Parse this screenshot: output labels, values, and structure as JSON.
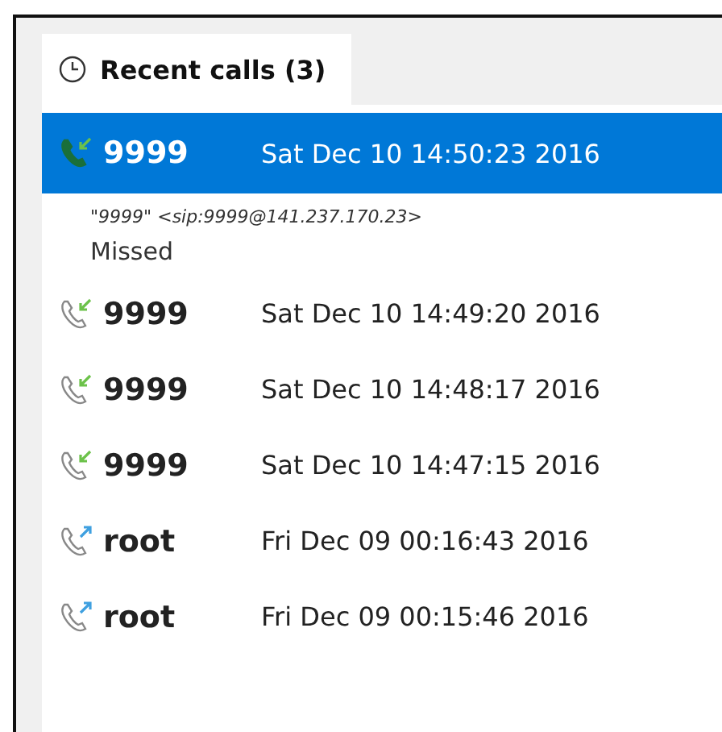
{
  "tab": {
    "label": "Recent calls (3)",
    "selected": true
  },
  "calls": [
    {
      "kind": "incoming",
      "name": "9999",
      "time": "Sat Dec 10 14:50:23 2016",
      "selected": true,
      "expanded": true,
      "address": "\"9999\" <sip:9999@141.237.170.23>",
      "status": "Missed"
    },
    {
      "kind": "incoming",
      "name": "9999",
      "time": "Sat Dec 10 14:49:20 2016",
      "selected": false,
      "expanded": false
    },
    {
      "kind": "incoming",
      "name": "9999",
      "time": "Sat Dec 10 14:48:17 2016",
      "selected": false,
      "expanded": false
    },
    {
      "kind": "incoming",
      "name": "9999",
      "time": "Sat Dec 10 14:47:15 2016",
      "selected": false,
      "expanded": false
    },
    {
      "kind": "outgoing",
      "name": "root",
      "time": "Fri Dec 09 00:16:43 2016",
      "selected": false,
      "expanded": false
    },
    {
      "kind": "outgoing",
      "name": "root",
      "time": "Fri Dec 09 00:15:46 2016",
      "selected": false,
      "expanded": false
    }
  ]
}
